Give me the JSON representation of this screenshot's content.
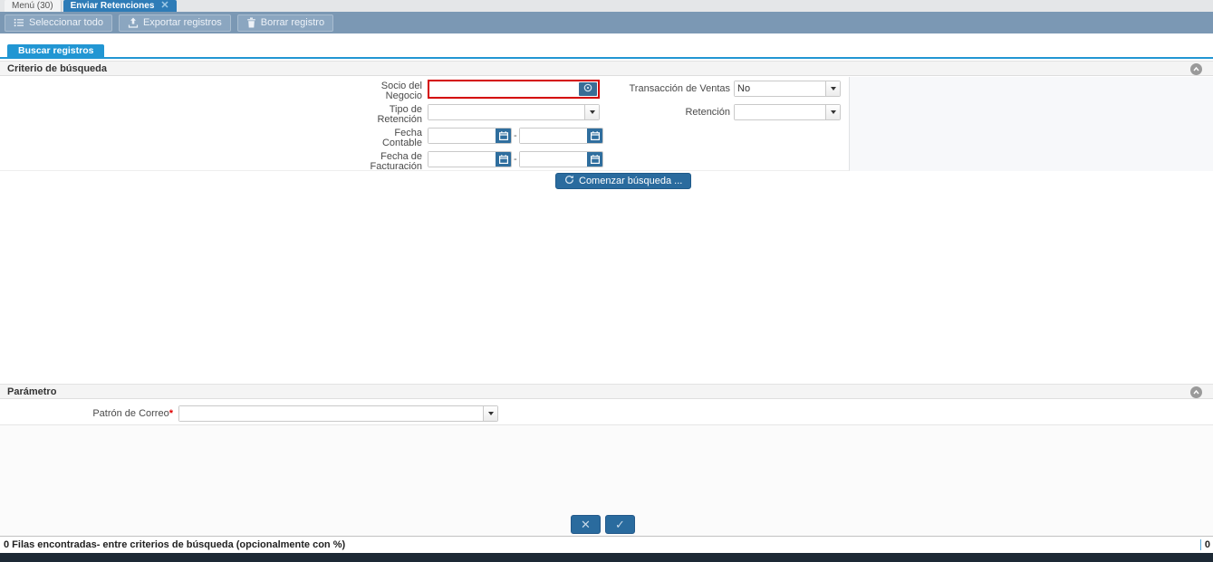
{
  "window_tabs": {
    "menu_tab": "Menú (30)",
    "active_tab": "Enviar Retenciones"
  },
  "toolbar": {
    "select_all_label": "Seleccionar todo",
    "export_label": "Exportar registros",
    "delete_label": "Borrar registro"
  },
  "search_tab_label": "Buscar registros",
  "criteria_panel": {
    "title": "Criterio de búsqueda",
    "bpartner": {
      "label": "Socio del Negocio",
      "value": ""
    },
    "sales_transaction": {
      "label": "Transacción de Ventas",
      "value": "No"
    },
    "retention_type": {
      "label": "Tipo de Retención",
      "value": ""
    },
    "retention": {
      "label": "Retención",
      "value": ""
    },
    "date_acct": {
      "label": "Fecha Contable",
      "from": "",
      "to": "",
      "separator": "-"
    },
    "date_invoiced": {
      "label": "Fecha de Facturación",
      "from": "",
      "to": "",
      "separator": "-"
    },
    "search_button_label": "Comenzar búsqueda ..."
  },
  "parameter_panel": {
    "title": "Parámetro",
    "mail_pattern": {
      "label": "Patrón de Correo",
      "required_marker": "*",
      "value": ""
    }
  },
  "status_bar": {
    "message": "0 Filas encontradas- entre criterios de búsqueda (opcionalmente con %)",
    "record_count": "0"
  },
  "icons": {
    "close_glyph": "✕",
    "cancel_glyph": "✕",
    "confirm_glyph": "✓"
  },
  "colors": {
    "active_tab": "#2e7cb7",
    "toolbar_bg": "#7b98b4",
    "search_tab": "#2196d3",
    "accent_button": "#2a6b9e",
    "required_field_border": "#d40000",
    "bottom_bar": "#1d2935"
  }
}
